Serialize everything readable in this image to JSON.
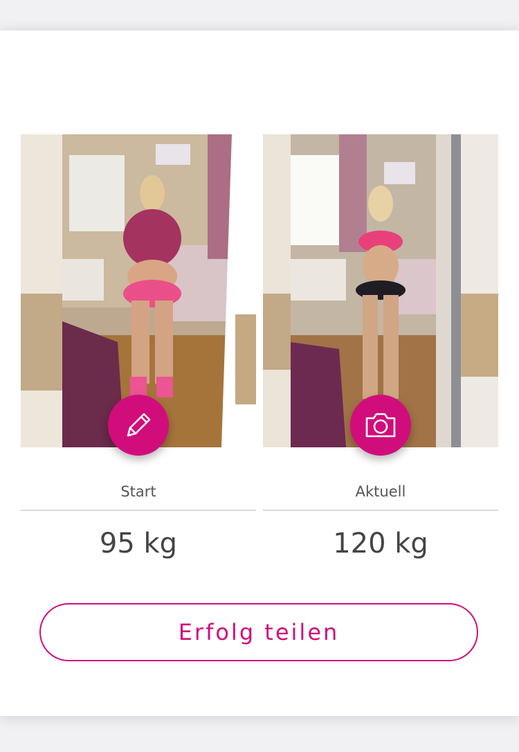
{
  "progress": {
    "start": {
      "label": "Start",
      "weight": "95 kg",
      "action_icon": "pencil-icon",
      "photo": "before-photo"
    },
    "current": {
      "label": "Aktuell",
      "weight": "120 kg",
      "action_icon": "camera-icon",
      "photo": "current-photo"
    }
  },
  "share_button": {
    "label": "Erfolg teilen"
  },
  "colors": {
    "accent": "#d10d7c",
    "background": "#ffffff",
    "page_bg": "#f1f1f4",
    "text": "#555555"
  }
}
